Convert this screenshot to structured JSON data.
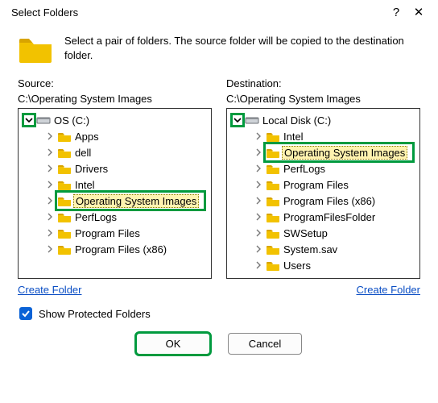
{
  "dialog": {
    "title": "Select Folders",
    "intro": "Select a pair of folders.  The source folder will be copied to the destination folder."
  },
  "source": {
    "label": "Source:",
    "path": "C:\\Operating System Images",
    "root_label": "OS (C:)",
    "items": [
      {
        "label": "Apps"
      },
      {
        "label": "dell"
      },
      {
        "label": "Drivers"
      },
      {
        "label": "Intel"
      },
      {
        "label": "Operating System Images",
        "selected": true
      },
      {
        "label": "PerfLogs"
      },
      {
        "label": "Program Files"
      },
      {
        "label": "Program Files (x86)"
      }
    ],
    "create_label": "Create Folder"
  },
  "destination": {
    "label": "Destination:",
    "path": "C:\\Operating System Images",
    "root_label": "Local Disk (C:)",
    "items": [
      {
        "label": "Intel"
      },
      {
        "label": "Operating System Images",
        "selected": true
      },
      {
        "label": "PerfLogs"
      },
      {
        "label": "Program Files"
      },
      {
        "label": "Program Files (x86)"
      },
      {
        "label": "ProgramFilesFolder"
      },
      {
        "label": "SWSetup"
      },
      {
        "label": "System.sav"
      },
      {
        "label": "Users"
      }
    ],
    "create_label": "Create Folder"
  },
  "show_protected_label": "Show Protected Folders",
  "show_protected_checked": true,
  "buttons": {
    "ok": "OK",
    "cancel": "Cancel"
  },
  "icons": {
    "help": "?",
    "close": "✕"
  }
}
